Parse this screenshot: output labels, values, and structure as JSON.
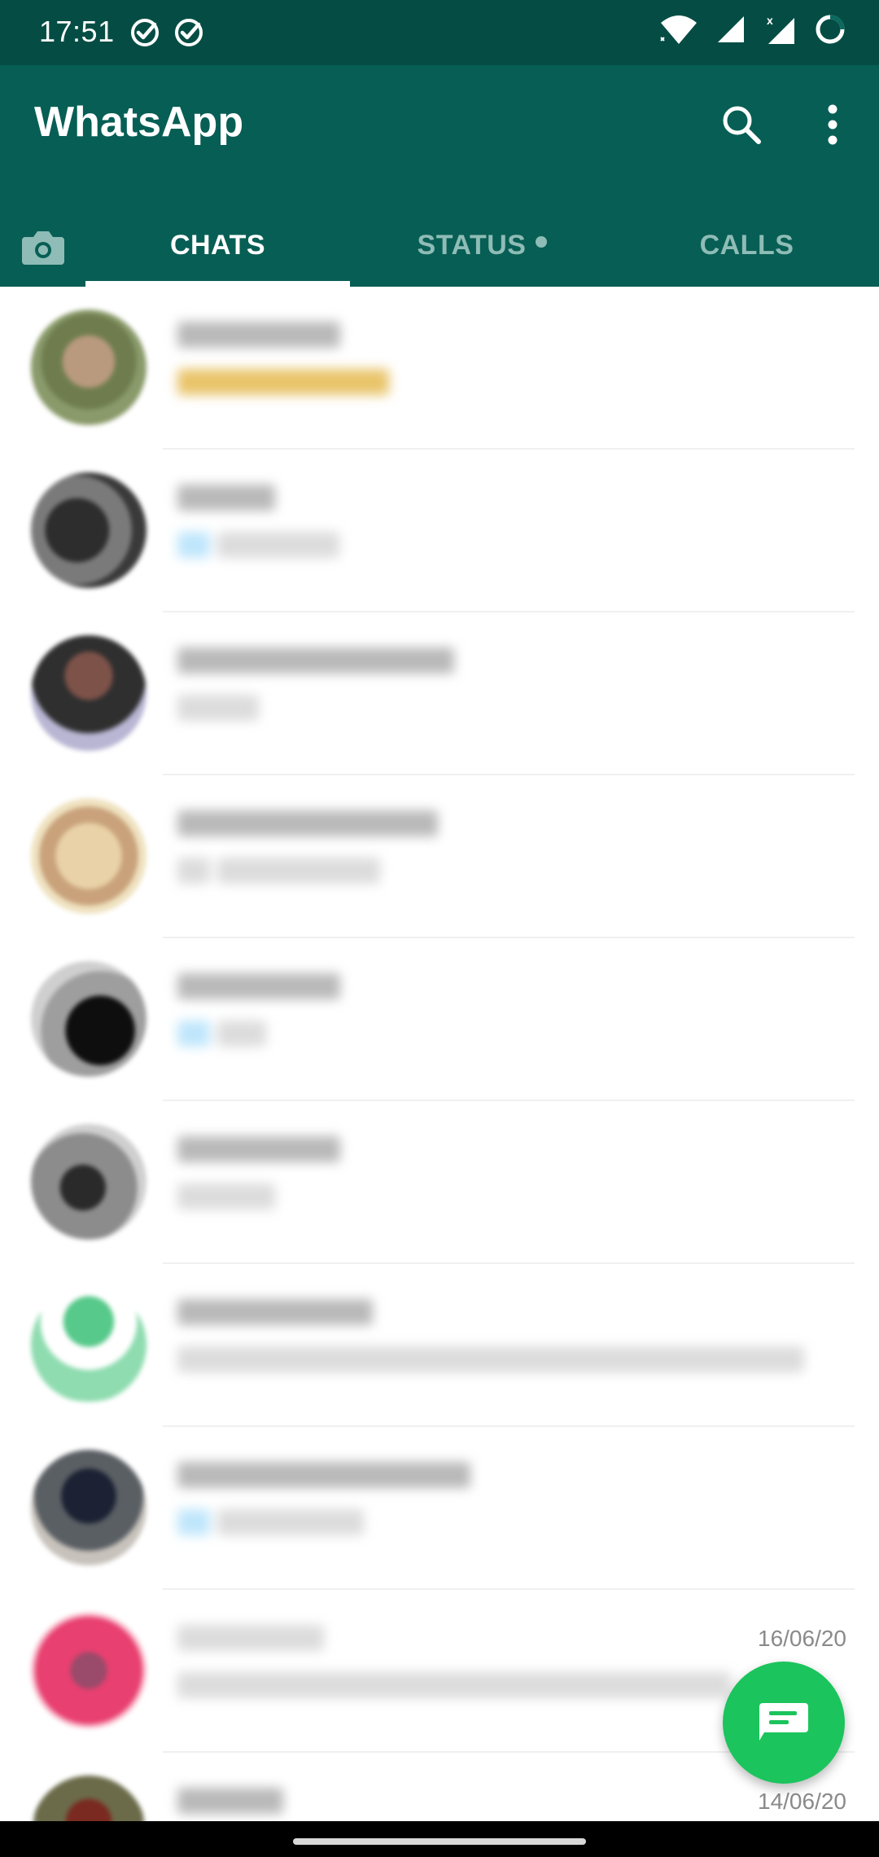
{
  "status_bar": {
    "time": "17:51",
    "left_icons": [
      "check-circle-icon",
      "check-circle-icon"
    ],
    "right_icons": [
      "wifi-icon",
      "signal-icon",
      "signal-x-icon",
      "loading-ring-icon"
    ]
  },
  "app_bar": {
    "title": "WhatsApp",
    "actions": [
      "search-icon",
      "more-vert-icon"
    ]
  },
  "tabs": {
    "chats": "CHATS",
    "status": "STATUS",
    "calls": "CALLS",
    "active": "CHATS"
  },
  "chats": [
    {
      "time": ""
    },
    {
      "time": ""
    },
    {
      "time": ""
    },
    {
      "time": ""
    },
    {
      "time": ""
    },
    {
      "time": ""
    },
    {
      "time": ""
    },
    {
      "time": ""
    },
    {
      "time": "16/06/20"
    },
    {
      "time": "14/06/20"
    }
  ],
  "colors": {
    "status_bar": "#054d44",
    "app_bar": "#075e54",
    "fab": "#1bc45c",
    "inactive_tab": "#8fbcb6"
  }
}
